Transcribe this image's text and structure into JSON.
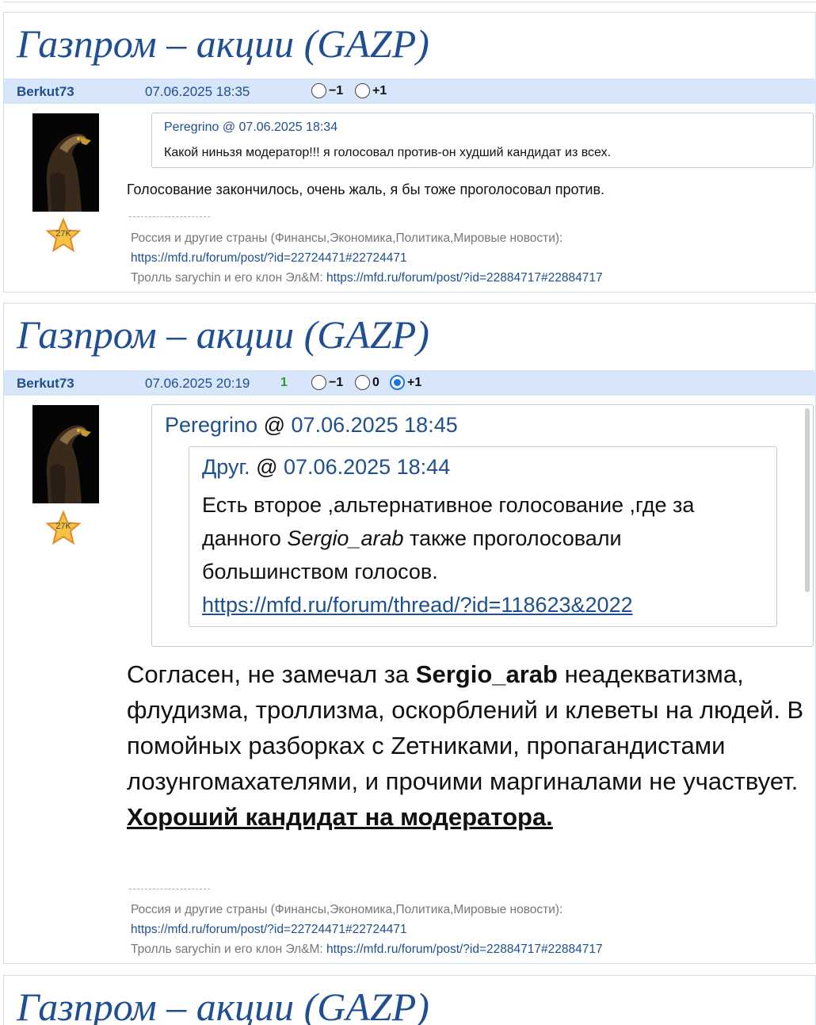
{
  "thread_title": "Газпром – акции (GAZP)",
  "posts": [
    {
      "author": "Berkut73",
      "date": "07.06.2025 18:35",
      "score": "",
      "votes": [
        "−1",
        "+1"
      ],
      "rank_badge": "27K",
      "quote": {
        "author": "Peregrino",
        "at": "@",
        "date": "07.06.2025 18:34",
        "text": "Какой ниньзя модератор!!! я голосовал против-он худший кандидат из всех."
      },
      "body": "Голосование закончилось, очень жаль, я бы тоже проголосовал против.",
      "signature": {
        "line1": "Россия и другие страны (Финансы,Экономика,Политика,Мировые новости):",
        "link1": "https://mfd.ru/forum/post/?id=22724471#22724471",
        "line3_prefix": "Тролль sarychin и его клон Эл&M:",
        "link2": "https://mfd.ru/forum/post/?id=22884717#22884717"
      }
    },
    {
      "author": "Berkut73",
      "date": "07.06.2025 20:19",
      "score": "1",
      "votes": [
        "−1",
        "0",
        "+1"
      ],
      "rank_badge": "27K",
      "quote": {
        "author": "Peregrino",
        "at": "@",
        "date": "07.06.2025 18:45",
        "inner": {
          "author": "Друг.",
          "at": "@",
          "date": "07.06.2025 18:44",
          "text_1": "Есть второе ,альтернативное голосование ,где за данного",
          "italic_name": "Sergio_arab",
          "text_2": "также проголосовали большинством голосов.",
          "link": "https://mfd.ru/forum/thread/?id=118623&2022"
        }
      },
      "body": {
        "part1": "Согласен, не замечал за",
        "bold_name": "Sergio_arab",
        "part2": "неадекватизма, флудизма, троллизма, оскорблений и клеветы на людей. В помойных разборках с Zетниками, пропагандистами лозунгомахателями, и прочими маргиналами не участвует.",
        "emphasis": "Хороший кандидат на модератора."
      },
      "signature": {
        "line1": "Россия и другие страны (Финансы,Экономика,Политика,Мировые новости):",
        "link1": "https://mfd.ru/forum/post/?id=22724471#22724471",
        "line3_prefix": "Тролль sarychin и его клон Эл&M:",
        "link2": "https://mfd.ru/forum/post/?id=22884717#22884717"
      }
    }
  ],
  "colors": {
    "title": "#1f4e93",
    "meta_bar": "#d8e6fb",
    "link": "#1e4f8f",
    "score": "#2a9a2a"
  },
  "icons": [
    "eagle-avatar",
    "star-rank-icon",
    "radio-icon"
  ]
}
